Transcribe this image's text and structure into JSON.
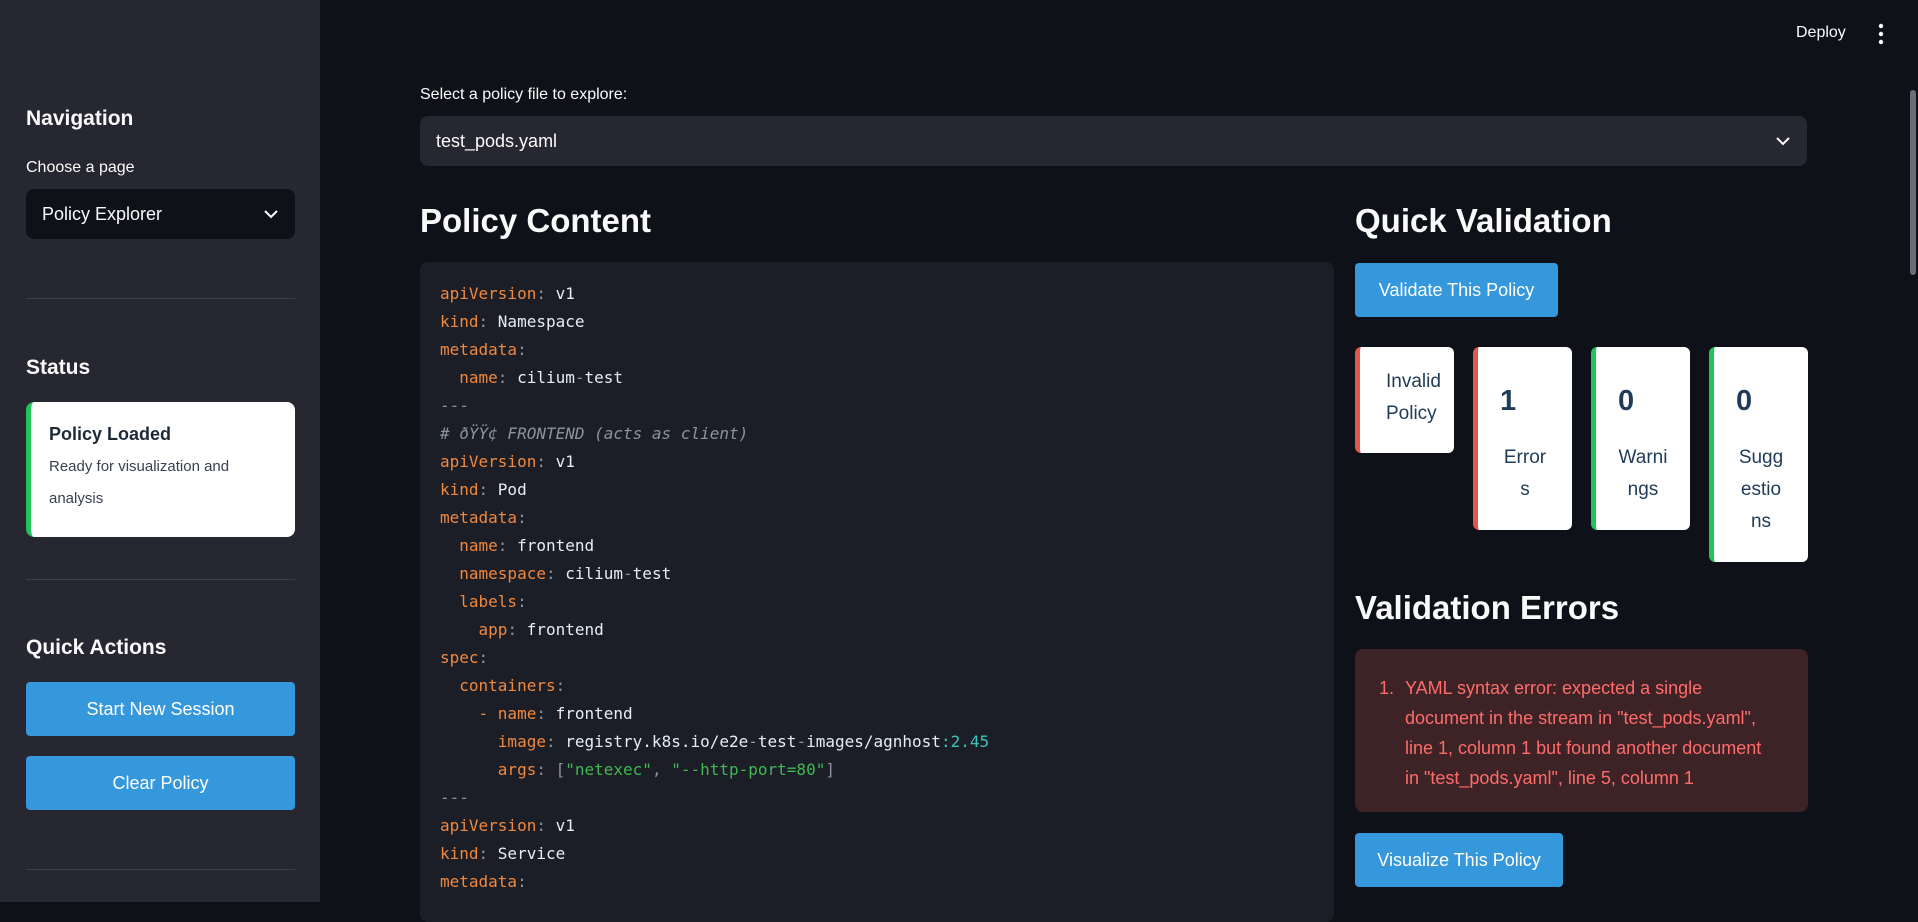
{
  "colors": {
    "background": "#0e1117",
    "sidebar": "#262730",
    "accent_button": "#3598dc",
    "success_border": "#21c35b",
    "error_border": "#e0584b",
    "error_text": "#ff6b6b",
    "error_bg": "#3e2326"
  },
  "header": {
    "deploy_label": "Deploy",
    "menu_icon": "vertical-ellipsis-icon"
  },
  "sidebar": {
    "navigation_heading": "Navigation",
    "choose_page_label": "Choose a page",
    "page_select_value": "Policy Explorer",
    "status_heading": "Status",
    "status_card": {
      "title": "Policy Loaded",
      "subtitle": "Ready for visualization and analysis"
    },
    "quick_actions_heading": "Quick Actions",
    "start_session_label": "Start New Session",
    "clear_policy_label": "Clear Policy"
  },
  "main": {
    "file_select_label": "Select a policy file to explore:",
    "file_select_value": "test_pods.yaml",
    "policy_content_heading": "Policy Content",
    "code_lines": [
      [
        {
          "t": "apiVersion",
          "c": "k"
        },
        {
          "t": ": ",
          "c": "g"
        },
        {
          "t": "v1",
          "c": "v"
        }
      ],
      [
        {
          "t": "kind",
          "c": "k"
        },
        {
          "t": ": ",
          "c": "g"
        },
        {
          "t": "Namespace",
          "c": "v"
        }
      ],
      [
        {
          "t": "metadata",
          "c": "k"
        },
        {
          "t": ":",
          "c": "g"
        }
      ],
      [
        {
          "t": "  "
        },
        {
          "t": "name",
          "c": "k"
        },
        {
          "t": ": ",
          "c": "g"
        },
        {
          "t": "cilium",
          "c": "v"
        },
        {
          "t": "-",
          "c": "g"
        },
        {
          "t": "test",
          "c": "v"
        }
      ],
      [
        {
          "t": "---",
          "c": "g"
        }
      ],
      [
        {
          "t": "# ðŸŸ¢ FRONTEND (acts as client)",
          "c": "c"
        }
      ],
      [
        {
          "t": "apiVersion",
          "c": "k"
        },
        {
          "t": ": ",
          "c": "g"
        },
        {
          "t": "v1",
          "c": "v"
        }
      ],
      [
        {
          "t": "kind",
          "c": "k"
        },
        {
          "t": ": ",
          "c": "g"
        },
        {
          "t": "Pod",
          "c": "v"
        }
      ],
      [
        {
          "t": "metadata",
          "c": "k"
        },
        {
          "t": ":",
          "c": "g"
        }
      ],
      [
        {
          "t": "  "
        },
        {
          "t": "name",
          "c": "k"
        },
        {
          "t": ": ",
          "c": "g"
        },
        {
          "t": "frontend",
          "c": "v"
        }
      ],
      [
        {
          "t": "  "
        },
        {
          "t": "namespace",
          "c": "k"
        },
        {
          "t": ": ",
          "c": "g"
        },
        {
          "t": "cilium",
          "c": "v"
        },
        {
          "t": "-",
          "c": "g"
        },
        {
          "t": "test",
          "c": "v"
        }
      ],
      [
        {
          "t": "  "
        },
        {
          "t": "labels",
          "c": "k"
        },
        {
          "t": ":",
          "c": "g"
        }
      ],
      [
        {
          "t": "    "
        },
        {
          "t": "app",
          "c": "k"
        },
        {
          "t": ": ",
          "c": "g"
        },
        {
          "t": "frontend",
          "c": "v"
        }
      ],
      [
        {
          "t": "spec",
          "c": "k"
        },
        {
          "t": ":",
          "c": "g"
        }
      ],
      [
        {
          "t": "  "
        },
        {
          "t": "containers",
          "c": "k"
        },
        {
          "t": ":",
          "c": "g"
        }
      ],
      [
        {
          "t": "    "
        },
        {
          "t": "- ",
          "c": "k"
        },
        {
          "t": "name",
          "c": "k"
        },
        {
          "t": ": ",
          "c": "g"
        },
        {
          "t": "frontend",
          "c": "v"
        }
      ],
      [
        {
          "t": "      "
        },
        {
          "t": "image",
          "c": "k"
        },
        {
          "t": ": ",
          "c": "g"
        },
        {
          "t": "registry.k8s.io/e2e",
          "c": "v"
        },
        {
          "t": "-",
          "c": "g"
        },
        {
          "t": "test",
          "c": "v"
        },
        {
          "t": "-",
          "c": "g"
        },
        {
          "t": "images/agnhost",
          "c": "v"
        },
        {
          "t": ":2.45",
          "c": "n"
        }
      ],
      [
        {
          "t": "      "
        },
        {
          "t": "args",
          "c": "k"
        },
        {
          "t": ": ",
          "c": "g"
        },
        {
          "t": "[",
          "c": "g"
        },
        {
          "t": "\"netexec\"",
          "c": "s"
        },
        {
          "t": ", ",
          "c": "g"
        },
        {
          "t": "\"--http-port=80\"",
          "c": "s"
        },
        {
          "t": "]",
          "c": "g"
        }
      ],
      [
        {
          "t": "---",
          "c": "g"
        }
      ],
      [
        {
          "t": "apiVersion",
          "c": "k"
        },
        {
          "t": ": ",
          "c": "g"
        },
        {
          "t": "v1",
          "c": "v"
        }
      ],
      [
        {
          "t": "kind",
          "c": "k"
        },
        {
          "t": ": ",
          "c": "g"
        },
        {
          "t": "Service",
          "c": "v"
        }
      ],
      [
        {
          "t": "metadata",
          "c": "k"
        },
        {
          "t": ":",
          "c": "g"
        }
      ]
    ],
    "quick_validation_heading": "Quick Validation",
    "validate_button_label": "Validate This Policy",
    "metrics": {
      "invalid_line1": "Invalid",
      "invalid_line2": "Policy",
      "errors_value": "1",
      "errors_label_1": "Error",
      "errors_label_2": "s",
      "warnings_value": "0",
      "warnings_label_1": "Warni",
      "warnings_label_2": "ngs",
      "suggestions_value": "0",
      "suggestions_label_1": "Sugg",
      "suggestions_label_2": "estio",
      "suggestions_label_3": "ns"
    },
    "validation_errors_heading": "Validation Errors",
    "error_number": "1.",
    "error_lines": [
      "YAML syntax error: expected a single",
      "document in the stream in \"test_pods.yaml\",",
      "line 1, column 1 but found another document",
      "in \"test_pods.yaml\", line 5, column 1"
    ],
    "visualize_button_label": "Visualize This Policy"
  }
}
